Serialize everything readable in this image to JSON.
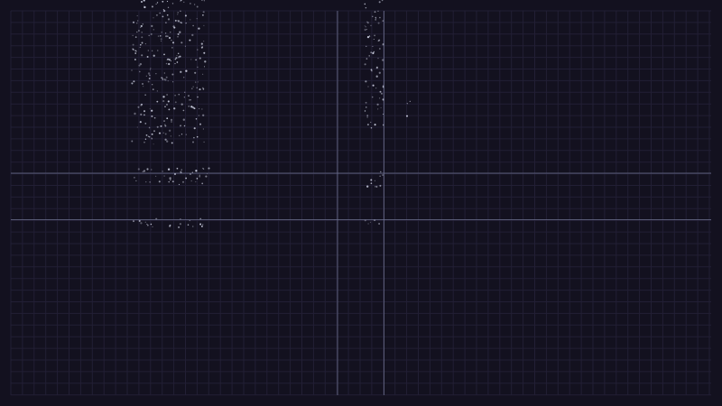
{
  "scene": {
    "background_color": "#13111f",
    "grid_color": "#221f35",
    "guide_color": "#6f7392",
    "particle_color": "#cfd2e3",
    "grid_visible": true
  }
}
